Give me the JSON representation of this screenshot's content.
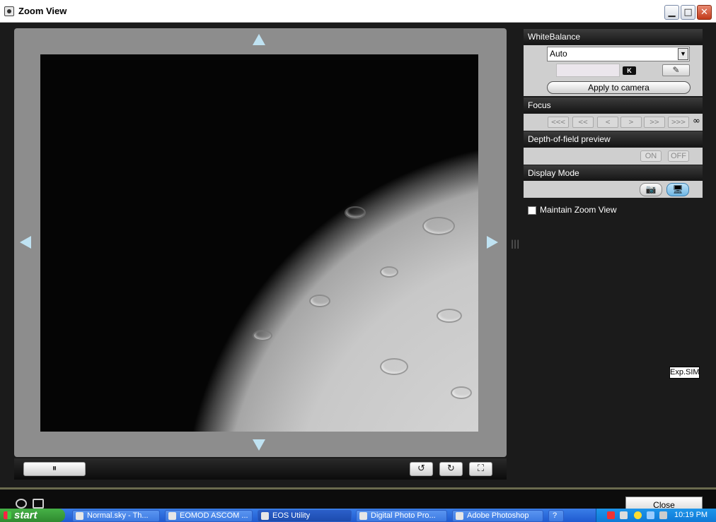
{
  "window": {
    "title": "Zoom View",
    "controls": {
      "minimize": "▁",
      "maximize": "□",
      "close": "✕"
    }
  },
  "preview": {
    "pause_symbol": "⏸",
    "rotate_left_symbol": "↺",
    "rotate_right_symbol": "↻",
    "fit_symbol": "⛶"
  },
  "white_balance": {
    "header": "WhiteBalance",
    "mode": "Auto",
    "kelvin_badge": "K",
    "apply_label": "Apply to camera"
  },
  "focus": {
    "header": "Focus",
    "buttons": [
      "<<<",
      "<<",
      "<",
      ">",
      ">>",
      ">>>"
    ],
    "infinity": "∞"
  },
  "dof": {
    "header": "Depth-of-field preview",
    "on": "ON",
    "off": "OFF"
  },
  "display_mode": {
    "header": "Display Mode"
  },
  "maintain_zoom": {
    "label": "Maintain Zoom View",
    "checked": false
  },
  "exp_sim": "Exp.SIM",
  "close_label": "Close",
  "taskbar": {
    "start": "start",
    "tasks": [
      "Normal.sky - Th...",
      "EOMOD ASCOM ...",
      "EOS Utility",
      "Digital Photo Pro...",
      "Adobe Photoshop"
    ],
    "clock": "10:19 PM"
  }
}
